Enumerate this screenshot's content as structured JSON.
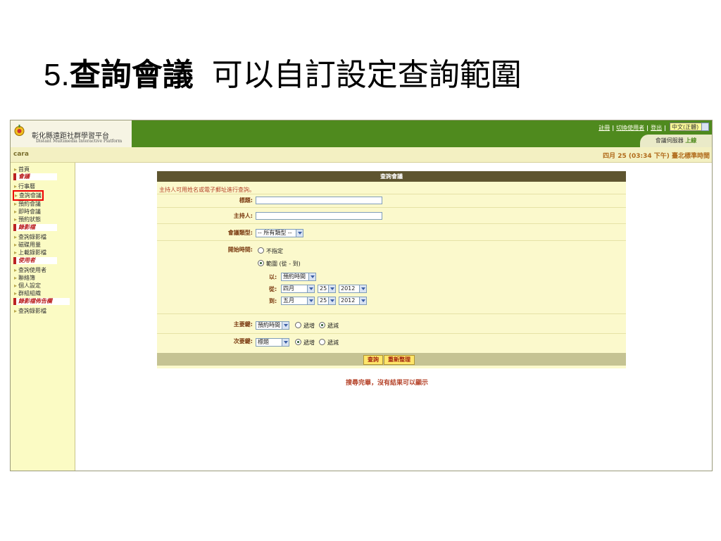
{
  "slide": {
    "number": "5.",
    "title_bold": "查詢會議",
    "subtitle": "可以自訂設定查詢範圍"
  },
  "header": {
    "logo_cn": "彰化縣遠距社群學習平台",
    "logo_en": "Distant Multimedia Interactive Platform",
    "links": [
      "註冊",
      "切換使用者",
      "登出"
    ],
    "language_select": "中文(正體)",
    "server_label": "會議伺服器",
    "server_status": "上線",
    "username": "cara",
    "clock": "四月 25 (03:34 下午) 臺北標準時間"
  },
  "sidebar": {
    "items": [
      {
        "type": "item",
        "label": "首頁"
      },
      {
        "type": "section",
        "label": "會議"
      },
      {
        "type": "item",
        "label": "行事曆"
      },
      {
        "type": "item",
        "label": "查詢會議",
        "active": true
      },
      {
        "type": "item",
        "label": "預約會議"
      },
      {
        "type": "item",
        "label": "即時會議"
      },
      {
        "type": "item",
        "label": "預約狀態"
      },
      {
        "type": "section",
        "label": "錄影檔"
      },
      {
        "type": "item",
        "label": "查詢錄影檔"
      },
      {
        "type": "item",
        "label": "磁碟用量"
      },
      {
        "type": "item",
        "label": "上載錄影檔"
      },
      {
        "type": "section",
        "label": "使用者"
      },
      {
        "type": "item",
        "label": "查詢使用者"
      },
      {
        "type": "item",
        "label": "聯絡簿"
      },
      {
        "type": "item",
        "label": "個人設定"
      },
      {
        "type": "item",
        "label": "群組組織"
      },
      {
        "type": "section",
        "label": "錄影檔佈告欄"
      },
      {
        "type": "item",
        "label": "查詢錄影檔"
      }
    ]
  },
  "form": {
    "heading": "查詢會議",
    "hint": "主持人可用姓名或電子郵址進行查詢。",
    "title_label": "標題:",
    "title_value": "",
    "host_label": "主持人:",
    "host_value": "",
    "type_label": "會議類型:",
    "type_value": "-- 所有類型 --",
    "start_label": "開始時間:",
    "opt_unspecified": "不指定",
    "opt_range": "範圍 (從 - 到)",
    "by_label": "以:",
    "by_value": "預約時間",
    "from_label": "從:",
    "from_month": "四月",
    "from_day": "25",
    "from_year": "2012",
    "to_label": "到:",
    "to_month": "五月",
    "to_day": "25",
    "to_year": "2012",
    "primary_label": "主要鍵:",
    "primary_value": "預約時間",
    "secondary_label": "次要鍵:",
    "secondary_value": "標題",
    "asc": "遞增",
    "desc": "遞減",
    "search_button": "查詢",
    "reset_button": "重新整理"
  },
  "result_message": "搜尋完畢，沒有結果可以顯示"
}
